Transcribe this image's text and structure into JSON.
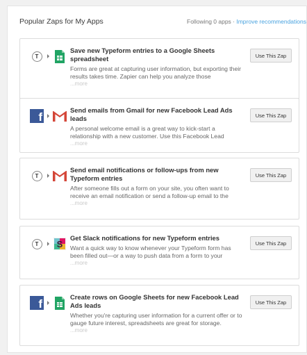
{
  "header": {
    "title": "Popular Zaps for My Apps",
    "following": "Following 0 apps · ",
    "improve_link": "Improve recommendations"
  },
  "colors": {
    "link": "#4aa3df",
    "facebook": "#3b5998",
    "gmail_red": "#d44638",
    "sheets_green": "#21a464"
  },
  "zaps": [
    {
      "from_icon": "typeform-icon",
      "to_icon": "google-sheets-icon",
      "title": "Save new Typeform entries to a Google Sheets spreadsheet",
      "description": "Forms are great at capturing user information, but exporting their results takes time. Zapier can help you analyze those",
      "more": "...more",
      "button": "Use This Zap"
    },
    {
      "from_icon": "facebook-icon",
      "to_icon": "gmail-icon",
      "title": "Send emails from Gmail for new Facebook Lead Ads leads",
      "description": "A personal welcome email is a great way to kick-start a relationship with a new customer. Use this Facebook Lead",
      "more": "...more",
      "button": "Use This Zap"
    },
    {
      "from_icon": "typeform-icon",
      "to_icon": "gmail-icon",
      "title": "Send email notifications or follow-ups from new Typeform entries",
      "description": "After someone fills out a form on your site, you often want to receive an email notification or send a follow-up email to the",
      "more": "...more",
      "button": "Use This Zap"
    },
    {
      "from_icon": "typeform-icon",
      "to_icon": "slack-icon",
      "title": "Get Slack notifications for new Typeform entries",
      "description": "Want a quick way to know whenever your Typeform form has been filled out—or a way to push data from a form to your",
      "more": "...more",
      "button": "Use This Zap"
    },
    {
      "from_icon": "facebook-icon",
      "to_icon": "google-sheets-icon",
      "title": "Create rows on Google Sheets for new Facebook Lead Ads leads",
      "description": "Whether you're capturing user information for a current offer or to gauge future interest, spreadsheets are great for storage.",
      "more": "...more",
      "button": "Use This Zap"
    }
  ]
}
